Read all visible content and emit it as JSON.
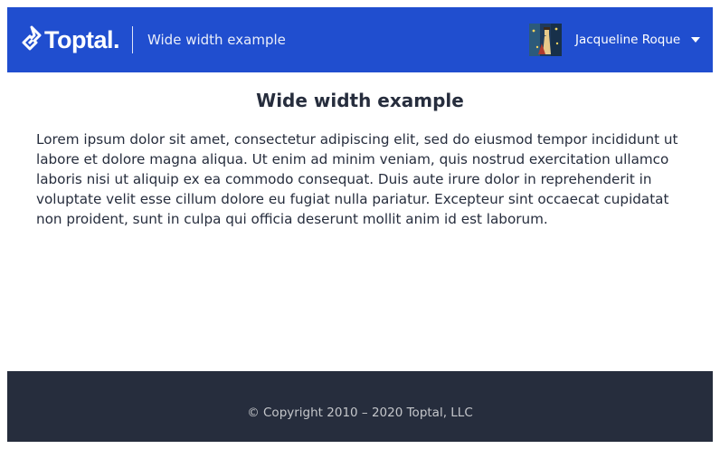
{
  "header": {
    "logo_text": "Toptal",
    "logo_dot": ".",
    "page_heading": "Wide width example",
    "user": {
      "name": "Jacqueline Roque",
      "avatar_icon": "user-avatar-image",
      "caret_icon": "caret-down-icon"
    }
  },
  "main": {
    "title": "Wide width example",
    "body": "Lorem ipsum dolor sit amet, consectetur adipiscing elit, sed do eiusmod tempor incididunt ut labore et dolore magna aliqua. Ut enim ad minim veniam, quis nostrud exercitation ullamco laboris nisi ut aliquip ex ea commodo consequat. Duis aute irure dolor in reprehenderit in voluptate velit esse cillum dolore eu fugiat nulla pariatur. Excepteur sint occaecat cupidatat non proident, sunt in culpa qui officia deserunt mollit anim id est laborum."
  },
  "footer": {
    "copyright": "© Copyright 2010 – 2020 Toptal, LLC"
  },
  "colors": {
    "header_bg": "#204ecf",
    "text_dark": "#262d3d",
    "footer_bg": "#262d3d",
    "footer_text": "#c4c6ca"
  }
}
